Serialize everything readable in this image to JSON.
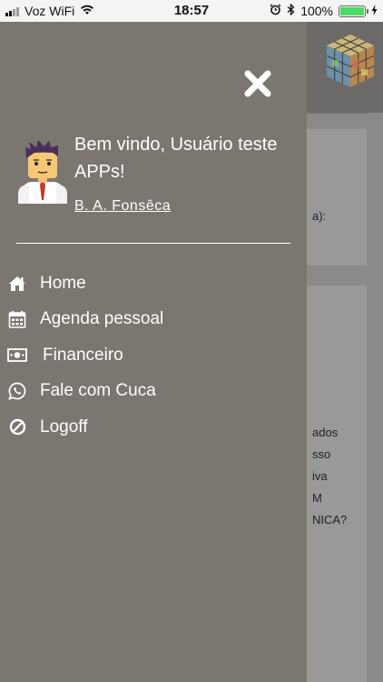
{
  "status_bar": {
    "carrier": "Voz WiFi",
    "time": "18:57",
    "battery_percent": "100%",
    "battery_level": 1.0
  },
  "drawer": {
    "welcome_text": "Bem vindo, Usuário teste APPs!",
    "user_name": "B. A. Fonsêca",
    "menu": [
      {
        "label": "Home",
        "icon": "home-icon"
      },
      {
        "label": "Agenda pessoal",
        "icon": "calendar-icon"
      },
      {
        "label": "Financeiro",
        "icon": "money-icon"
      },
      {
        "label": "Fale com Cuca",
        "icon": "whatsapp-icon"
      },
      {
        "label": "Logoff",
        "icon": "ban-icon"
      }
    ]
  },
  "background": {
    "card1_text": "a):",
    "card2_lines": [
      "ados",
      "sso",
      "iva",
      "M",
      "NICA?"
    ]
  },
  "colors": {
    "drawer_bg": "#7b7670",
    "status_bg": "#f4f4f4",
    "battery_fill": "#4cd964"
  }
}
